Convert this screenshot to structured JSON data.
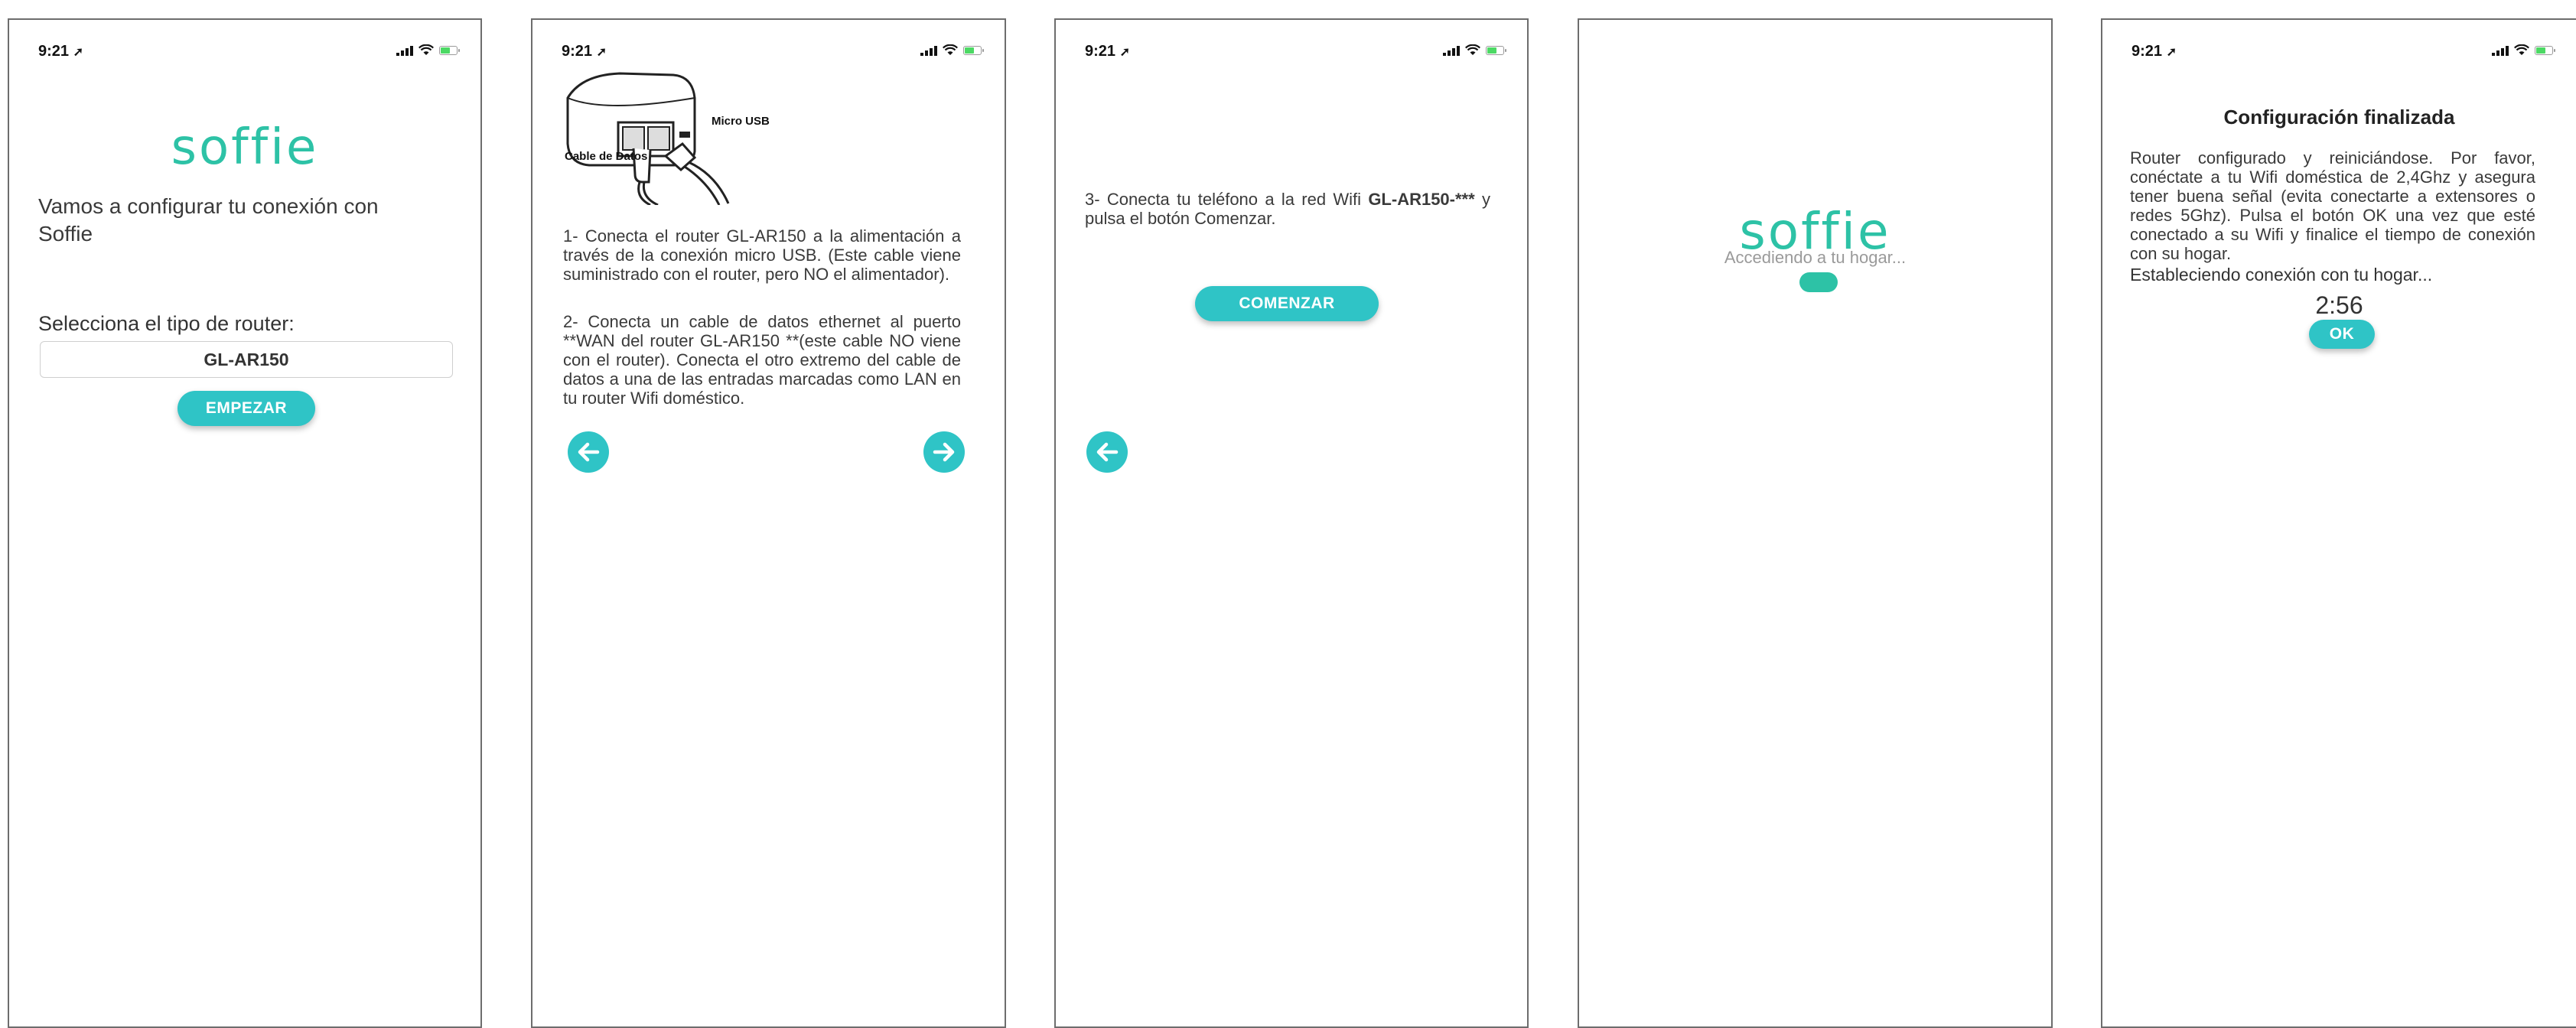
{
  "status_time": "9:21",
  "colors": {
    "accent": "#2fc4c6",
    "logo": "#2dc2a6",
    "border": "#6d6d6d"
  },
  "screen1": {
    "logo": "soffie",
    "intro": "Vamos a configurar tu conexión con Soffie",
    "router_label": "Selecciona el tipo de router:",
    "router_value": "GL-AR150",
    "start_button": "EMPEZAR"
  },
  "screen2": {
    "image_labels": {
      "micro_usb": "Micro USB",
      "cable": "Cable de Datos"
    },
    "step1": "1- Conecta el router GL-AR150 a la alimentación a través de la conexión micro USB. (Este cable viene suministrado con el router, pero NO el alimentador).",
    "step2": "2- Conecta un cable de datos ethernet al puerto **WAN del router GL-AR150 **(este cable NO viene con el router). Conecta el otro extremo del cable de datos a una de las entradas marcadas como LAN en tu router Wifi doméstico."
  },
  "screen3": {
    "step3_prefix": "3- Conecta tu teléfono a la red Wifi ",
    "step3_network": "GL-AR150-***",
    "step3_suffix": " y pulsa el botón Comenzar.",
    "start_button": "COMENZAR"
  },
  "screen4": {
    "logo": "soffie",
    "loading_text": "Accediendo a tu hogar..."
  },
  "screen5": {
    "title": "Configuración finalizada",
    "message": "Router configurado y reiniciándose. Por favor, conéctate a tu Wifi doméstica de 2,4Ghz y asegura tener buena señal (evita conectarte a extensores o redes 5Ghz). Pulsa el botón OK una vez que esté conectado a su Wifi y finalice el tiempo de conexión con su hogar.",
    "status": "Estableciendo conexión con tu hogar...",
    "countdown": "2:56",
    "ok_button": "OK"
  }
}
